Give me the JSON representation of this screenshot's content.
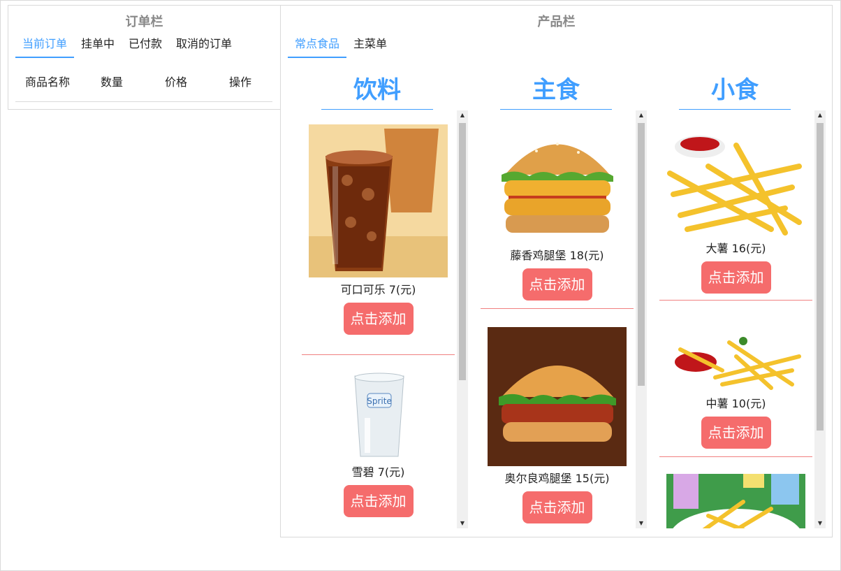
{
  "order_panel": {
    "title": "订单栏",
    "tabs": [
      "当前订单",
      "挂单中",
      "已付款",
      "取消的订单"
    ],
    "columns": [
      "商品名称",
      "数量",
      "价格",
      "操作"
    ]
  },
  "product_panel": {
    "title": "产品栏",
    "tabs": [
      "常点食品",
      "主菜单"
    ],
    "add_label": "点击添加",
    "categories": [
      {
        "title": "饮料",
        "items": [
          {
            "name": "可口可乐",
            "price": "7(元)",
            "image": "cola-image"
          },
          {
            "name": "雪碧",
            "price": "7(元)",
            "image": "sprite-glass-image"
          }
        ]
      },
      {
        "title": "主食",
        "items": [
          {
            "name": "藤香鸡腿堡",
            "price": "18(元)",
            "image": "chicken-burger-image"
          },
          {
            "name": "奥尔良鸡腿堡",
            "price": "15(元)",
            "image": "orleans-burger-image"
          }
        ]
      },
      {
        "title": "小食",
        "items": [
          {
            "name": "大薯",
            "price": "16(元)",
            "image": "large-fries-image"
          },
          {
            "name": "中薯",
            "price": "10(元)",
            "image": "medium-fries-image"
          },
          {
            "name": "",
            "price": "",
            "image": "fries-partial-image"
          }
        ]
      }
    ]
  },
  "colors": {
    "accent": "#409eff",
    "button": "#f56c6c",
    "divider": "#f08080"
  }
}
